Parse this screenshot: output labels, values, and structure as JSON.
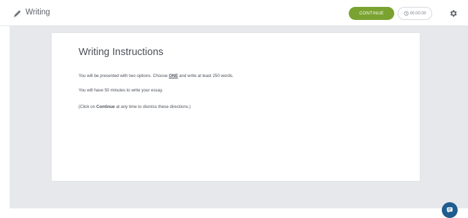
{
  "header": {
    "title": "Writing",
    "continue_label": "CONTINUE",
    "timer_value": "00:00:00",
    "icons": [
      "pencil-icon",
      "clock-icon",
      "gear-icon"
    ]
  },
  "instructions": {
    "heading": "Writing Instructions",
    "line1_pre": "You will be presented with two options. Choose ",
    "line1_bold": "ONE",
    "line1_post": " and write at least 250 words.",
    "line2": "You will have 50 minutes to write your essay.",
    "line3_pre": "(Click on ",
    "line3_bold": "Continue",
    "line3_post": " at any time to dismiss these directions.)"
  },
  "chat": {
    "icon": "chat-icon"
  },
  "colors": {
    "accent": "#7aa230",
    "workspace": "#e6e8eb",
    "chat": "#1f5d8f"
  }
}
